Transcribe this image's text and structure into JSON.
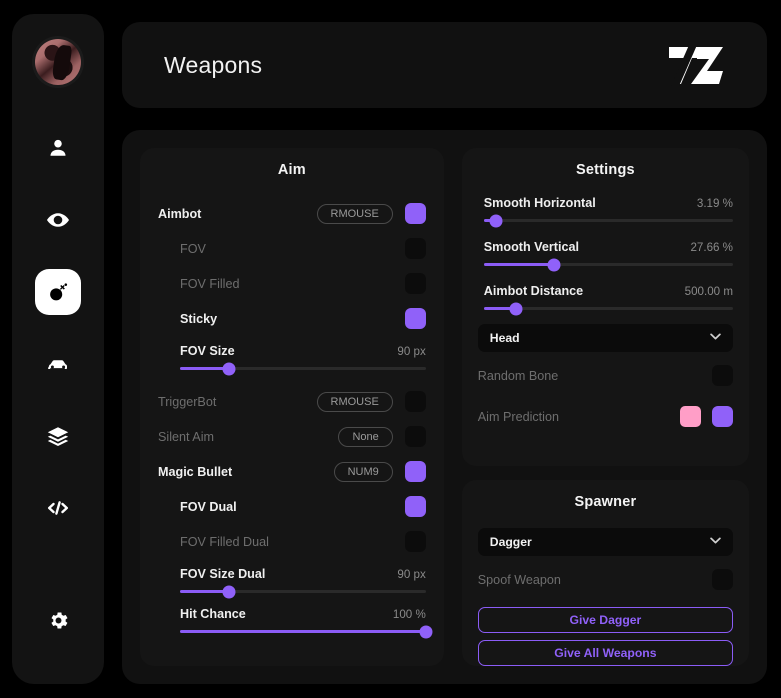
{
  "header": {
    "title": "Weapons",
    "logo_text": "TZ"
  },
  "sidebar": {
    "avatar_name": "user-avatar",
    "items": [
      {
        "icon": "person-icon",
        "name": "sidebar-item-player",
        "active": false
      },
      {
        "icon": "eye-icon",
        "name": "sidebar-item-visuals",
        "active": false
      },
      {
        "icon": "bomb-icon",
        "name": "sidebar-item-weapons",
        "active": true
      },
      {
        "icon": "car-icon",
        "name": "sidebar-item-vehicles",
        "active": false
      },
      {
        "icon": "layers-icon",
        "name": "sidebar-item-world",
        "active": false
      },
      {
        "icon": "code-icon",
        "name": "sidebar-item-scripts",
        "active": false
      },
      {
        "icon": "gear-icon",
        "name": "sidebar-item-settings",
        "active": false
      }
    ]
  },
  "aim": {
    "title": "Aim",
    "rows": [
      {
        "label": "Aimbot",
        "keybind": "RMOUSE",
        "toggle": true,
        "enabled": true,
        "indent": 0
      },
      {
        "label": "FOV",
        "keybind": null,
        "toggle": false,
        "enabled": false,
        "indent": 1
      },
      {
        "label": "FOV Filled",
        "keybind": null,
        "toggle": false,
        "enabled": false,
        "indent": 1
      },
      {
        "label": "Sticky",
        "keybind": null,
        "toggle": true,
        "enabled": true,
        "indent": 1
      }
    ],
    "slider_fov_size": {
      "label": "FOV Size",
      "value": "90 px",
      "percent": 20
    },
    "rows2": [
      {
        "label": "TriggerBot",
        "keybind": "RMOUSE",
        "toggle": false,
        "enabled": false,
        "indent": 0
      },
      {
        "label": "Silent Aim",
        "keybind": "None",
        "toggle": false,
        "enabled": false,
        "indent": 0
      },
      {
        "label": "Magic Bullet",
        "keybind": "NUM9",
        "toggle": true,
        "enabled": true,
        "indent": 0
      },
      {
        "label": "FOV Dual",
        "keybind": null,
        "toggle": true,
        "enabled": true,
        "indent": 1
      },
      {
        "label": "FOV Filled Dual",
        "keybind": null,
        "toggle": false,
        "enabled": false,
        "indent": 1
      }
    ],
    "slider_fov_size_dual": {
      "label": "FOV Size Dual",
      "value": "90 px",
      "percent": 20
    },
    "slider_hit_chance": {
      "label": "Hit Chance",
      "value": "100 %",
      "percent": 100
    }
  },
  "settings": {
    "title": "Settings",
    "slider_smooth_horizontal": {
      "label": "Smooth Horizontal",
      "value": "3.19 %",
      "percent": 5
    },
    "slider_smooth_vertical": {
      "label": "Smooth Vertical",
      "value": "27.66 %",
      "percent": 28
    },
    "slider_aimbot_distance": {
      "label": "Aimbot Distance",
      "value": "500.00 m",
      "percent": 13
    },
    "bone_select": {
      "value": "Head"
    },
    "random_bone": {
      "label": "Random Bone",
      "toggle": false,
      "enabled": false
    },
    "aim_prediction": {
      "label": "Aim Prediction",
      "toggle": true,
      "enabled": false,
      "swatch_color": "#ff9ec7"
    }
  },
  "spawner": {
    "title": "Spawner",
    "weapon_select": {
      "value": "Dagger"
    },
    "spoof_weapon": {
      "label": "Spoof Weapon",
      "toggle": false,
      "enabled": false
    },
    "buttons": [
      {
        "label": "Give Dagger",
        "name": "give-dagger-button"
      },
      {
        "label": "Give All Weapons",
        "name": "give-all-weapons-button"
      }
    ]
  },
  "colors": {
    "accent": "#8b5cf6",
    "accent_light": "#9061f9",
    "pink": "#ff9ec7"
  }
}
